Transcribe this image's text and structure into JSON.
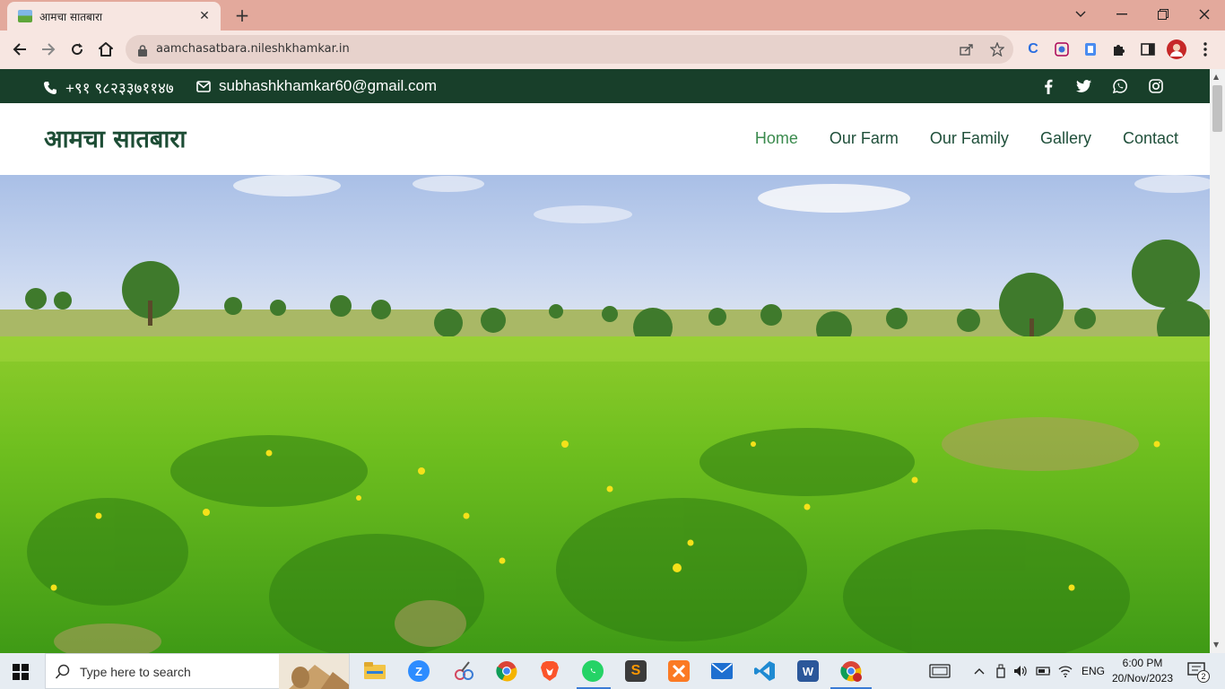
{
  "browser": {
    "tab_title": "आमचा सातबारा",
    "url": "aamchasatbara.nileshkhamkar.in"
  },
  "topbar": {
    "phone": "+९१ ९८२३३७११४७",
    "email": "subhashkhamkar60@gmail.com",
    "social_icons": [
      "facebook-icon",
      "twitter-icon",
      "whatsapp-icon",
      "instagram-icon"
    ]
  },
  "header": {
    "logo": "आमचा सातबारा",
    "nav": [
      {
        "label": "Home",
        "active": true
      },
      {
        "label": "Our Farm",
        "active": false
      },
      {
        "label": "Our Family",
        "active": false
      },
      {
        "label": "Gallery",
        "active": false
      },
      {
        "label": "Contact",
        "active": false
      }
    ]
  },
  "colors": {
    "topbar_bg": "#183f2a",
    "logo": "#1d4d35",
    "nav_active": "#3b8b4e",
    "nav": "#1f4f3a",
    "browser_tabbar": "#e3a99c"
  },
  "taskbar": {
    "search_placeholder": "Type here to search",
    "language": "ENG",
    "time": "6:00 PM",
    "date": "20/Nov/2023",
    "notification_count": "2",
    "apps": [
      "file-explorer-icon",
      "zoom-icon",
      "snipping-icon",
      "chrome-icon",
      "brave-icon",
      "whatsapp-icon",
      "sublime-icon",
      "xampp-icon",
      "mail-icon",
      "vscode-icon",
      "word-icon",
      "chrome-profile-icon"
    ]
  }
}
